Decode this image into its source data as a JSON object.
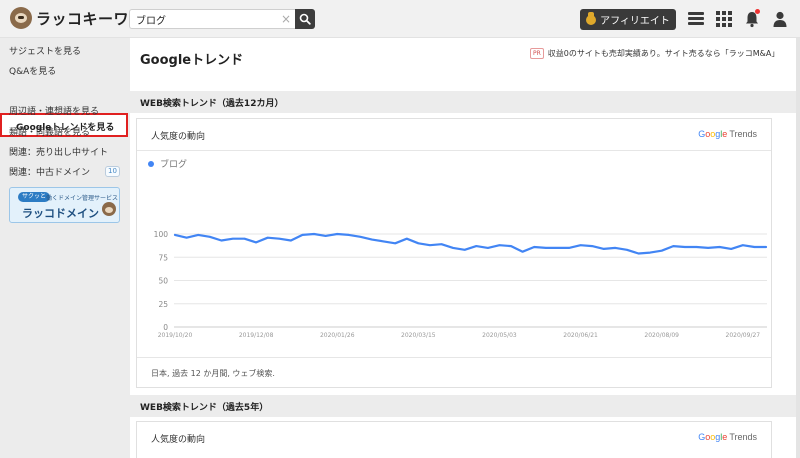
{
  "header": {
    "logo_text": "ラッコキーワード",
    "search": {
      "value": "ブログ",
      "clear_glyph": "×"
    },
    "affiliate_label": "アフィリエイト",
    "icons": [
      "hamburger-menu-icon",
      "grid-apps-icon",
      "bell-notification-icon",
      "user-account-icon"
    ]
  },
  "sidebar": {
    "items": [
      {
        "label": "サジェストを見る"
      },
      {
        "label": "Q&Aを見る"
      },
      {
        "label": "Googleトレンドを見る",
        "active": true
      },
      {
        "label": "周辺語・連想語を見る"
      },
      {
        "label": "類語・同義語を見る"
      },
      {
        "label": "関連：売り出し中サイト"
      },
      {
        "label": "関連：中古ドメイン",
        "badge": "10"
      }
    ],
    "banner": {
      "tag": "サクッと",
      "subtitle": "働くドメイン管理サービス",
      "title": "ラッコドメイン"
    }
  },
  "main": {
    "title": "Googleトレンド",
    "pr": {
      "tag": "PR",
      "text": "収益0のサイトも売却実績あり。サイト売るなら「ラッコM&A」"
    },
    "sections": [
      {
        "header": "WEB検索トレンド（過去12カ月）",
        "card_title": "人気度の動向",
        "brand": {
          "google": [
            "G",
            "o",
            "o",
            "g",
            "l",
            "e"
          ],
          "trends": "Trends"
        },
        "legend": "ブログ",
        "footer": "日本, 過去 12 か月間, ウェブ検索."
      },
      {
        "header": "WEB検索トレンド（過去5年）",
        "card_title": "人気度の動向",
        "brand": {
          "google": [
            "G",
            "o",
            "o",
            "g",
            "l",
            "e"
          ],
          "trends": "Trends"
        }
      }
    ]
  },
  "chart_data": {
    "type": "line",
    "series": [
      {
        "name": "ブログ",
        "color": "#4285f4",
        "values": [
          99,
          96,
          99,
          97,
          93,
          95,
          95,
          91,
          96,
          95,
          93,
          99,
          100,
          98,
          100,
          99,
          97,
          94,
          92,
          90,
          95,
          90,
          88,
          89,
          85,
          83,
          87,
          85,
          88,
          87,
          81,
          86,
          85,
          85,
          85,
          88,
          87,
          84,
          85,
          83,
          79,
          80,
          82,
          87,
          86,
          86,
          85,
          86,
          84,
          88,
          86,
          86
        ]
      }
    ],
    "x_tick_labels": [
      "2019/10/20",
      "2019/12/08",
      "2020/01/26",
      "2020/03/15",
      "2020/05/03",
      "2020/06/21",
      "2020/08/09",
      "2020/09/27"
    ],
    "x_tick_indices": [
      0,
      7,
      14,
      21,
      28,
      35,
      42,
      49
    ],
    "y_tick_labels": [
      "100",
      "75",
      "50",
      "25",
      "0"
    ],
    "y_tick_values": [
      100,
      75,
      50,
      25,
      0
    ],
    "ylim": [
      0,
      100
    ],
    "grid": true
  }
}
